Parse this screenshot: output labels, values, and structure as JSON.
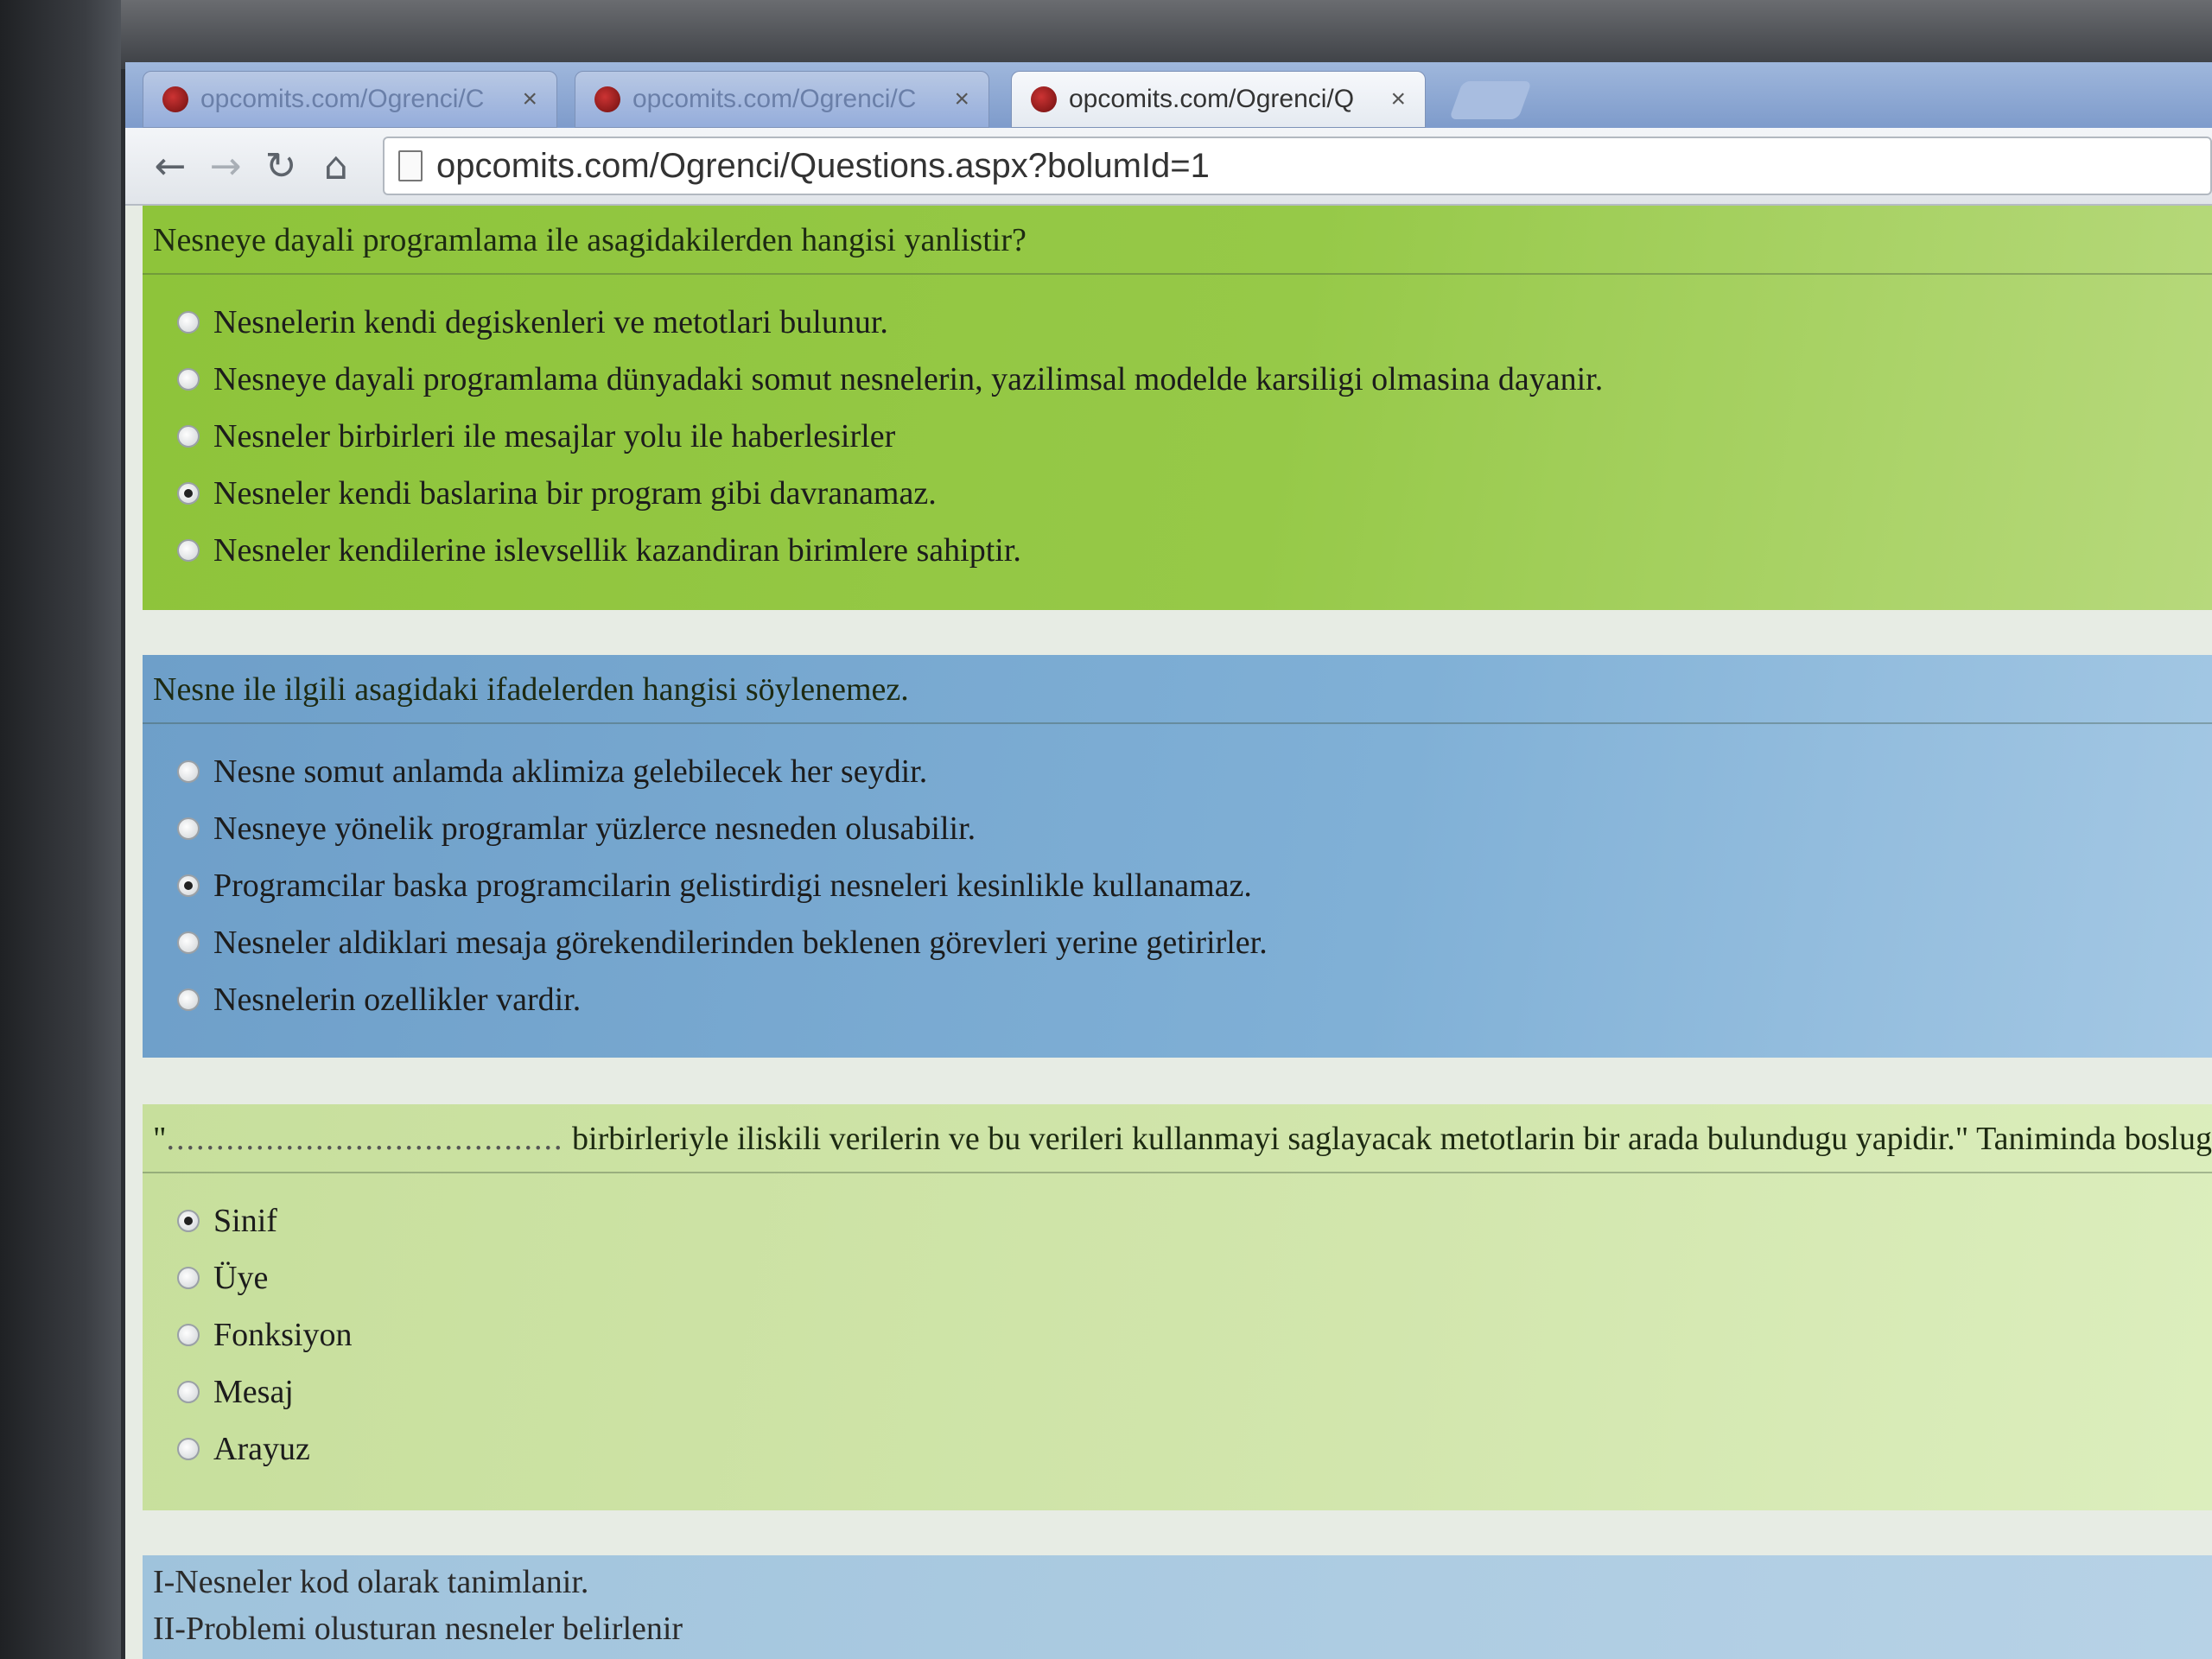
{
  "browser": {
    "tabs": [
      {
        "title": "opcomits.com/Ogrenci/C",
        "active": false
      },
      {
        "title": "opcomits.com/Ogrenci/C",
        "active": false
      },
      {
        "title": "opcomits.com/Ogrenci/Q",
        "active": true
      }
    ],
    "tab_close_glyph": "×",
    "address": "opcomits.com/Ogrenci/Questions.aspx?bolumId=1",
    "nav_icons": {
      "back": "←",
      "forward": "→",
      "reload": "↻",
      "home": "⌂"
    }
  },
  "questions": [
    {
      "text": "Nesneye dayali programlama ile asagidakilerden hangisi yanlistir?",
      "color": "green",
      "options": [
        {
          "label": "Nesnelerin kendi degiskenleri ve metotlari bulunur.",
          "checked": false
        },
        {
          "label": "Nesneye dayali programlama dünyadaki somut nesnelerin, yazilimsal modelde karsiligi olmasina dayanir.",
          "checked": false
        },
        {
          "label": "Nesneler birbirleri ile mesajlar yolu ile haberlesirler",
          "checked": false
        },
        {
          "label": "Nesneler kendi baslarina bir program gibi davranamaz.",
          "checked": true
        },
        {
          "label": "Nesneler kendilerine islevsellik kazandiran birimlere sahiptir.",
          "checked": false
        }
      ]
    },
    {
      "text": "Nesne ile ilgili asagidaki ifadelerden hangisi söylenemez.",
      "color": "blue",
      "options": [
        {
          "label": "Nesne somut anlamda aklimiza gelebilecek her seydir.",
          "checked": false
        },
        {
          "label": "Nesneye yönelik programlar yüzlerce nesneden olusabilir.",
          "checked": false
        },
        {
          "label": "Programcilar baska programcilarin gelistirdigi nesneleri kesinlikle kullanamaz.",
          "checked": true
        },
        {
          "label": "Nesneler aldiklari mesaja görekendilerinden beklenen görevleri yerine getirirler.",
          "checked": false
        },
        {
          "label": "Nesnelerin ozellikler vardir.",
          "checked": false
        }
      ]
    },
    {
      "text_prefix": "\"",
      "text_dots": "........................................",
      "text": " birbirleriyle iliskili verilerin ve bu verileri kullanmayi saglayacak metotlarin bir arada bulundugu yapidir.\" Taniminda boslug",
      "color": "lightgreen",
      "options": [
        {
          "label": "Sinif",
          "checked": true
        },
        {
          "label": "Üye",
          "checked": false
        },
        {
          "label": "Fonksiyon",
          "checked": false
        },
        {
          "label": "Mesaj",
          "checked": false
        },
        {
          "label": "Arayuz",
          "checked": false
        }
      ]
    },
    {
      "color": "lightblue",
      "lines": [
        "I-Nesneler kod olarak tanimlanir.",
        "II-Problemi olusturan nesneler belirlenir"
      ]
    }
  ]
}
